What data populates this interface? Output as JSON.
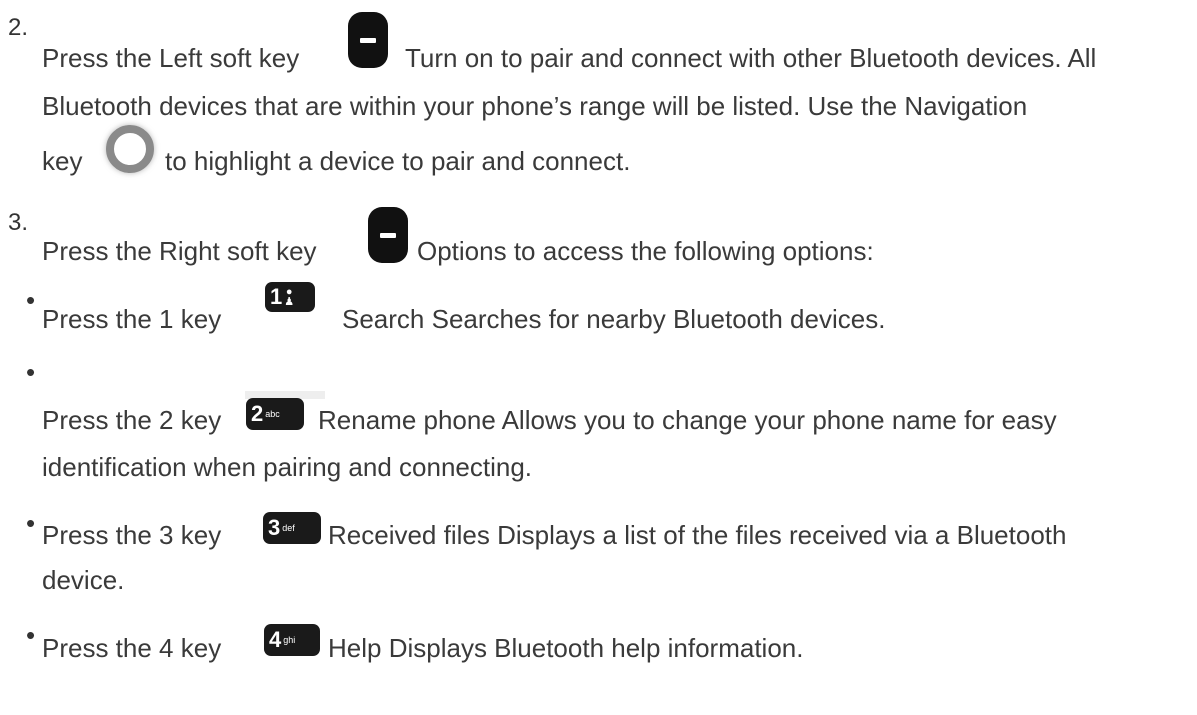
{
  "step2": {
    "number": "2.",
    "line1_a": "Press the Left soft key",
    "line1_b": "Turn on to pair and connect with other Bluetooth devices. All",
    "line2": "Bluetooth devices that are within your phone’s range will be listed. Use the Navigation",
    "line3_a": "key",
    "line3_b": "to highlight a device to pair and connect."
  },
  "step3": {
    "number": "3.",
    "line1_a": "Press the Right soft key",
    "line1_b": "Options to access the following options:"
  },
  "options": [
    {
      "text_a": "Press the 1 key",
      "text_b": "Search Searches for nearby Bluetooth devices.",
      "text_c": "",
      "key": {
        "digit": "1",
        "letters": ""
      }
    },
    {
      "text_a": "Press the 2 key",
      "text_b": "Rename phone Allows you to change your phone name for easy",
      "text_c": "identification when pairing and connecting.",
      "key": {
        "digit": "2",
        "letters": "abc"
      }
    },
    {
      "text_a": "Press the 3 key",
      "text_b": "Received files Displays a list of the files received via a Bluetooth",
      "text_c": "device.",
      "key": {
        "digit": "3",
        "letters": "def"
      }
    },
    {
      "text_a": "Press the 4 key",
      "text_b": "Help Displays Bluetooth help information.",
      "text_c": "",
      "key": {
        "digit": "4",
        "letters": "ghi"
      }
    }
  ],
  "icons": {
    "left_soft_key": "left-soft-key-icon",
    "navigation_key": "navigation-key-icon",
    "right_soft_key": "right-soft-key-icon",
    "key_1": "key-1-icon",
    "key_2": "key-2-icon",
    "key_3": "key-3-icon",
    "key_4": "key-4-icon"
  },
  "colors": {
    "text": "#333333",
    "key_body": "#1a1a1a",
    "nav_ring": "#8a8a8a"
  }
}
